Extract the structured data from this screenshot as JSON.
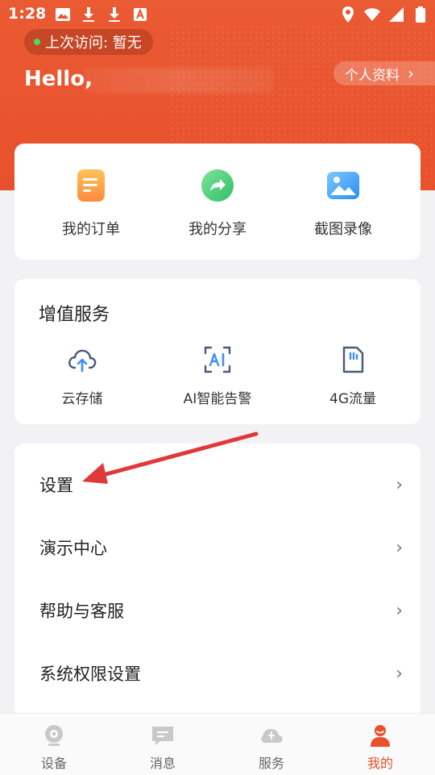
{
  "status_bar": {
    "time": "1:28"
  },
  "header": {
    "last_visit": "上次访问: 暂无",
    "greeting": "Hello,",
    "profile_link": "个人资料",
    "colors": {
      "brand": "#e8512b"
    }
  },
  "quick_actions": [
    {
      "label": "我的订单",
      "icon": "orders-icon"
    },
    {
      "label": "我的分享",
      "icon": "share-icon"
    },
    {
      "label": "截图录像",
      "icon": "screenshot-icon"
    }
  ],
  "value_services": {
    "title": "增值服务",
    "items": [
      {
        "label": "云存储",
        "icon": "cloud-upload-icon"
      },
      {
        "label": "AI智能告警",
        "icon": "ai-icon"
      },
      {
        "label": "4G流量",
        "icon": "sim-card-icon"
      }
    ]
  },
  "menu": [
    {
      "label": "设置"
    },
    {
      "label": "演示中心"
    },
    {
      "label": "帮助与客服"
    },
    {
      "label": "系统权限设置"
    }
  ],
  "tabbar": [
    {
      "label": "设备",
      "icon": "camera-icon",
      "active": false
    },
    {
      "label": "消息",
      "icon": "message-icon",
      "active": false
    },
    {
      "label": "服务",
      "icon": "service-icon",
      "active": false
    },
    {
      "label": "我的",
      "icon": "user-icon",
      "active": true
    }
  ]
}
